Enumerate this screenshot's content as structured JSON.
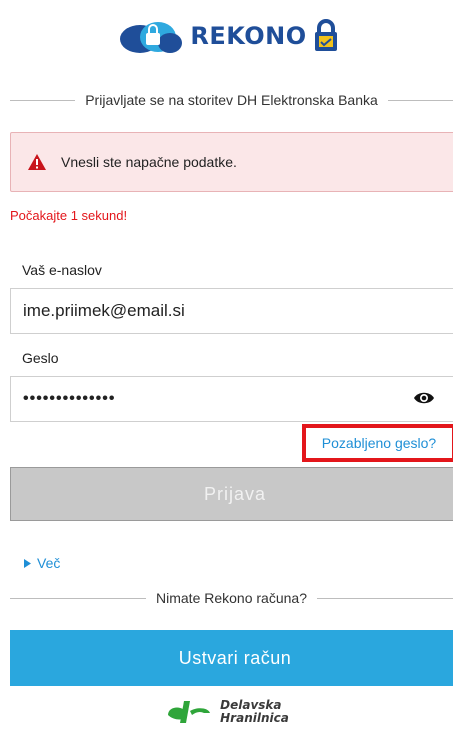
{
  "brand": {
    "name": "REKONO"
  },
  "service_title": "Prijavljate se na storitev DH Elektronska Banka",
  "alert": {
    "icon": "warning-icon",
    "message": "Vnesli ste napačne podatke.",
    "color": "#fbe7e8"
  },
  "countdown": "Počakajte 1 sekund!",
  "email": {
    "label": "Vaš e-naslov",
    "value": "ime.priimek@email.si"
  },
  "password": {
    "label": "Geslo",
    "value": "••••••••••••••",
    "toggle_icon": "eye-icon"
  },
  "forgot_link": "Pozabljeno geslo?",
  "login_button": "Prijava",
  "more_link": "Več",
  "no_account_title": "Nimate Rekono računa?",
  "create_button": "Ustvari račun",
  "partner": {
    "line1": "Delavska",
    "line2": "Hranilnica"
  },
  "colors": {
    "accent": "#2aa7de",
    "link": "#1f8fd6",
    "error": "#e3161b",
    "brand_dark": "#1f4e99"
  }
}
